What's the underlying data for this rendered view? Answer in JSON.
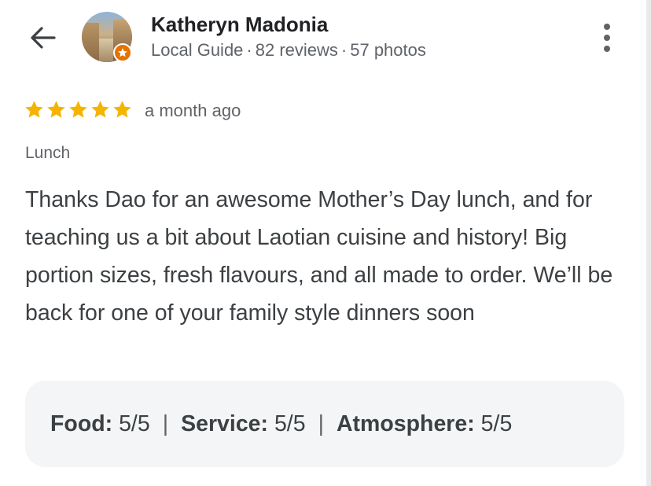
{
  "reviewer": {
    "name": "Katheryn Madonia",
    "level": "Local Guide",
    "reviews": "82 reviews",
    "photos": "57 photos",
    "separator": "·"
  },
  "icons": {
    "back": "arrow-back-icon",
    "more": "more-vert-icon",
    "badge": "local-guide-badge-icon",
    "star": "star-icon"
  },
  "review": {
    "rating": 5,
    "rating_max": 5,
    "time": "a month ago",
    "meal_type": "Lunch",
    "text": "Thanks Dao for an awesome Mother’s Day lunch, and for teaching us a bit about Laotian cuisine and history! Big portion sizes, fresh flavours, and all made to order. We’ll be back for one of your family style dinners soon"
  },
  "ratings": [
    {
      "label": "Food:",
      "value": "5/5"
    },
    {
      "label": "Service:",
      "value": "5/5"
    },
    {
      "label": "Atmosphere:",
      "value": "5/5"
    }
  ],
  "ratings_separator": "|",
  "colors": {
    "star": "#f4b400",
    "badge": "#e37400",
    "text_primary": "#202124",
    "text_secondary": "#5f6368",
    "chip_background": "#f4f5f6"
  }
}
